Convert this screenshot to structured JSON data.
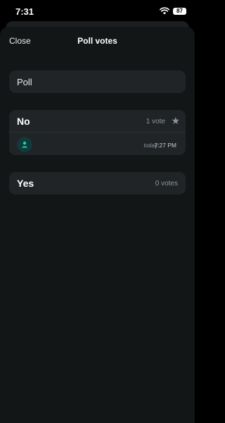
{
  "status_bar": {
    "time": "7:31",
    "battery": "87",
    "icons": [
      "wifi-icon",
      "battery-icon"
    ]
  },
  "header": {
    "close_label": "Close",
    "title": "Poll votes"
  },
  "poll": {
    "question": "Poll",
    "options": [
      {
        "label": "No",
        "votes_text": "1 vote",
        "winner_icon": "star-icon",
        "voters": [
          {
            "avatar_icon": "person-icon",
            "day": "today",
            "time": "7:27 PM"
          }
        ]
      },
      {
        "label": "Yes",
        "votes_text": "0 votes",
        "voters": []
      }
    ]
  },
  "colors": {
    "background": "#000000",
    "sheet": "#121617",
    "card": "#202427",
    "avatar_bg": "#103a3b",
    "avatar_accent": "#25d0a0"
  }
}
